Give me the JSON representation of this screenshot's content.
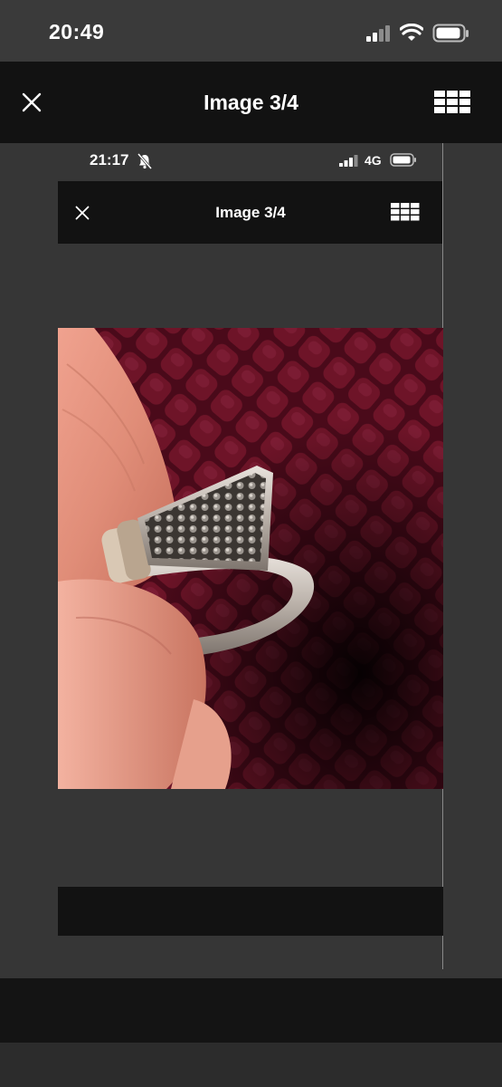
{
  "status_bar": {
    "time": "20:49",
    "icons": [
      "cellular-signal-icon",
      "wifi-icon",
      "battery-icon"
    ]
  },
  "header": {
    "title": "Image 3/4",
    "close_icon": "close-icon",
    "grid_icon": "grid-view-icon"
  },
  "inner_screenshot": {
    "status_bar": {
      "time": "21:17",
      "network": "4G",
      "icons": [
        "bell-muted-icon",
        "cellular-signal-icon",
        "battery-icon"
      ]
    },
    "header": {
      "title": "Image 3/4",
      "close_icon": "close-icon",
      "grid_icon": "grid-view-icon"
    },
    "photo": {
      "subject": "marcasite-ring-photo"
    }
  },
  "colors": {
    "background": "#363636",
    "header_bg": "#121212",
    "text": "#ffffff",
    "velvet": "#5a0c1e"
  }
}
